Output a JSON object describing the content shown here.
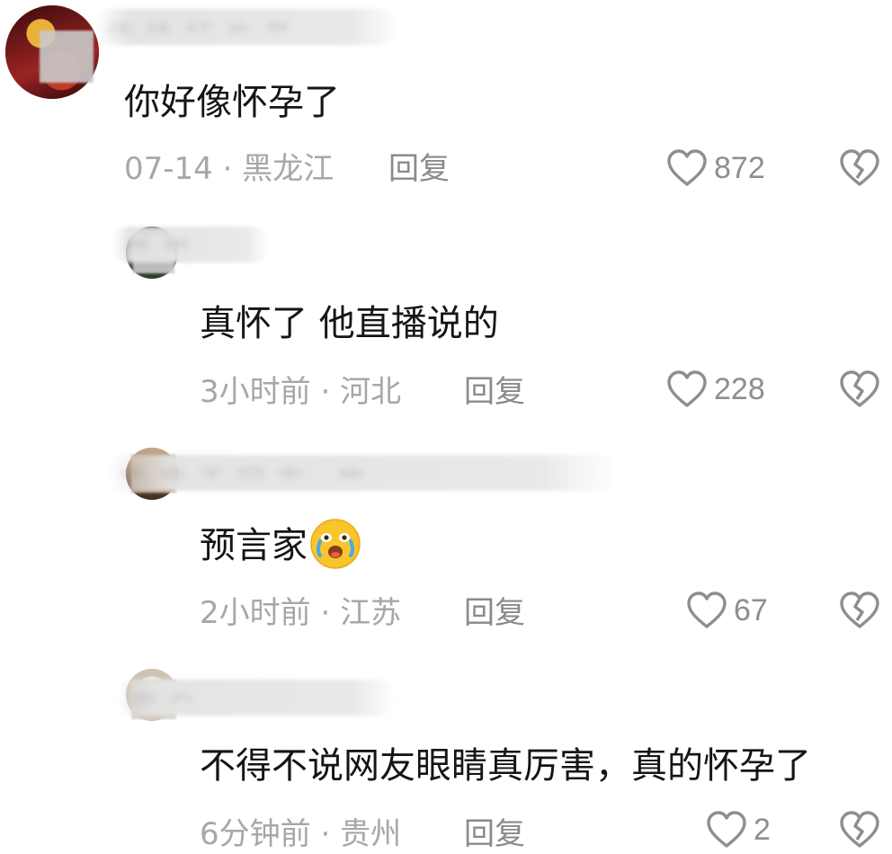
{
  "comments": [
    {
      "text": "你好像怀孕了",
      "date": "07-14",
      "location": "黑龙江",
      "reply_label": "回复",
      "likes": "872",
      "avatar_color": "#7b1e1e",
      "emoji": ""
    },
    {
      "text": "真怀了  他直播说的",
      "date": "3小时前",
      "location": "河北",
      "reply_label": "回复",
      "likes": "228",
      "avatar_color": "#3a4a3a",
      "emoji": ""
    },
    {
      "text": "预言家",
      "date": "2小时前",
      "location": "江苏",
      "reply_label": "回复",
      "likes": "67",
      "avatar_color": "#a0826a",
      "emoji": "crying-laughing-emoji"
    },
    {
      "text": "不得不说网友眼睛真厉害，真的怀孕了",
      "date": "6分钟前",
      "location": "贵州",
      "reply_label": "回复",
      "likes": "2",
      "avatar_color": "#d8d0c8",
      "emoji": ""
    }
  ],
  "separator": " · ",
  "colors": {
    "meta": "#a7a7a7",
    "icon": "#8e8e8e"
  }
}
